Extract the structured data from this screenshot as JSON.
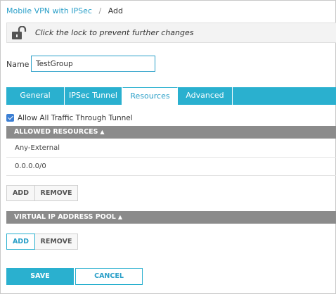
{
  "breadcrumb": {
    "parent": "Mobile VPN with IPSec",
    "separator": "/",
    "current": "Add"
  },
  "lockbar": {
    "icon": "unlocked-padlock-icon",
    "message": "Click the lock to prevent further changes"
  },
  "name_field": {
    "label": "Name",
    "value": "TestGroup"
  },
  "tabs": [
    {
      "label": "General",
      "active": false
    },
    {
      "label": "IPSec Tunnel",
      "active": false
    },
    {
      "label": "Resources",
      "active": true
    },
    {
      "label": "Advanced",
      "active": false
    }
  ],
  "allow_all": {
    "label": "Allow All Traffic Through Tunnel",
    "checked": true
  },
  "allowed_resources": {
    "header": "ALLOWED RESOURCES",
    "items": [
      "Any-External",
      "0.0.0.0/0"
    ],
    "add_label": "ADD",
    "remove_label": "REMOVE"
  },
  "virtual_ip_pool": {
    "header": "VIRTUAL IP ADDRESS POOL",
    "add_label": "ADD",
    "remove_label": "REMOVE"
  },
  "footer": {
    "save_label": "SAVE",
    "cancel_label": "CANCEL"
  },
  "colors": {
    "accent": "#2ab0cf",
    "section_header": "#8b8b8b",
    "link": "#2a9fc8"
  }
}
